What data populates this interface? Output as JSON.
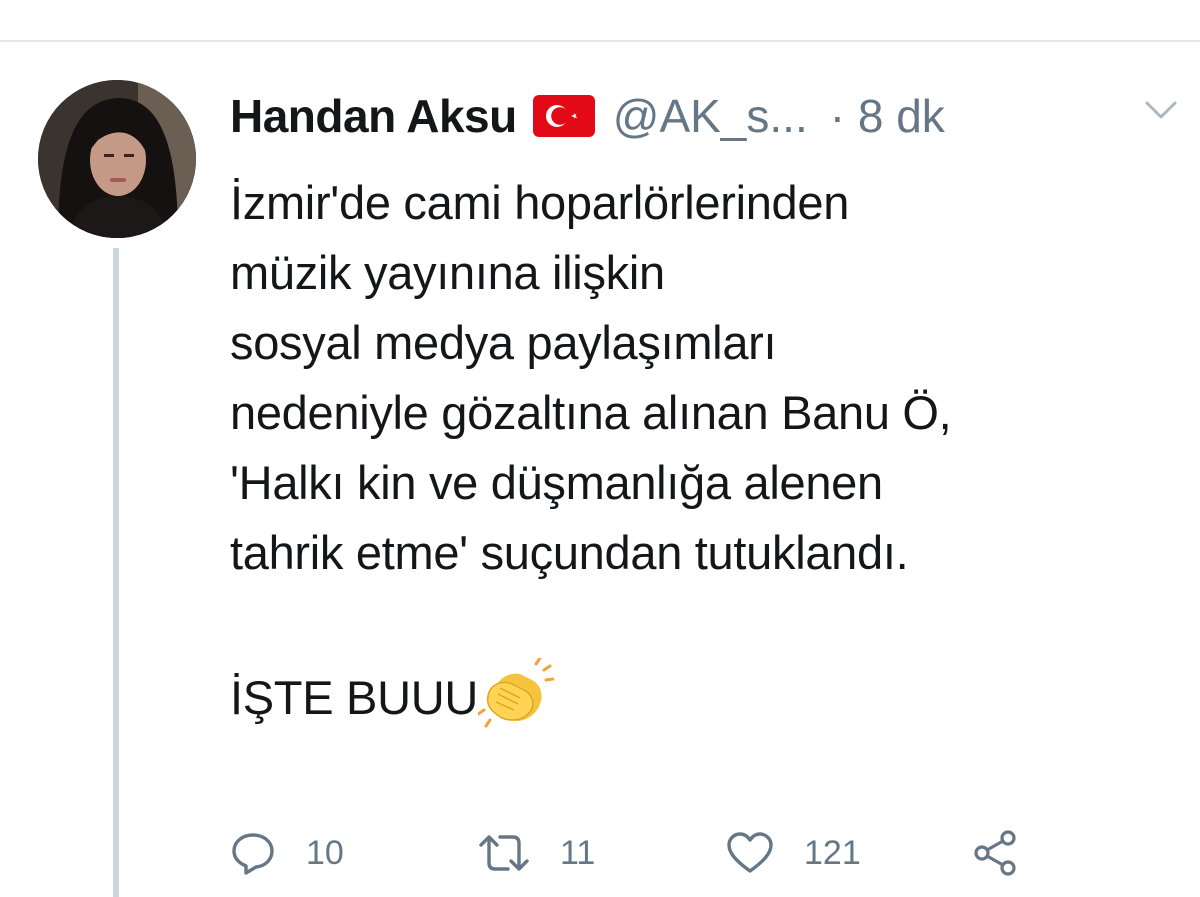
{
  "tweet": {
    "display_name": "Handan Aksu",
    "handle": "@AK_s...",
    "time": "· 8 dk",
    "body_lines": [
      "İzmir'de cami hoparlörlerinden",
      "müzik yayınına ilişkin",
      "sosyal medya paylaşımları",
      "nedeniyle gözaltına alınan Banu Ö,",
      "'Halkı kin ve düşmanlığa alenen",
      "tahrik etme' suçundan tutuklandı.",
      "",
      "İŞTE BUUU"
    ],
    "emoji": "clapping-hands",
    "stats": {
      "replies": "10",
      "retweets": "11",
      "likes": "121"
    }
  },
  "colors": {
    "text": "#14171a",
    "secondary": "#657786",
    "thread_line": "#ccd6dd",
    "flag_red": "#e30a17"
  },
  "icons": {
    "flag": "turkey-flag-icon",
    "caret": "chevron-down-icon",
    "reply": "reply-icon",
    "retweet": "retweet-icon",
    "like": "heart-icon",
    "share": "share-icon"
  }
}
